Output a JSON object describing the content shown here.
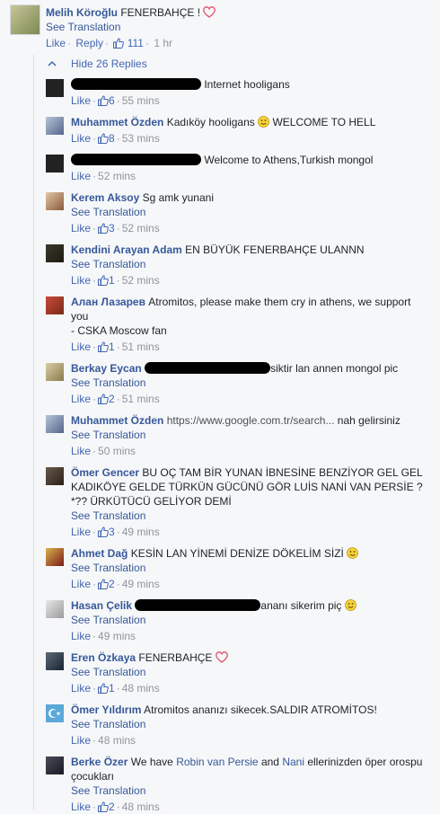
{
  "main_comment": {
    "author": "Melih Köroğlu",
    "text": "FENERBAHÇE !",
    "see_translation": "See Translation",
    "like": "Like",
    "reply": "Reply",
    "likes": "111",
    "time": "1 hr"
  },
  "hide_replies": "Hide 26 Replies",
  "replies": [
    {
      "author": "",
      "text": "Internet hooligans",
      "like": "Like",
      "likes": "6",
      "time": "55 mins"
    },
    {
      "author": "Muhammet Özden",
      "text": "Kadıköy hooligans",
      "text2": "WELCOME TO HELL",
      "like": "Like",
      "likes": "8",
      "time": "53 mins"
    },
    {
      "author": "",
      "text": "Welcome to Athens,Turkish mongol",
      "like": "Like",
      "time": "52 mins"
    },
    {
      "author": "Kerem Aksoy",
      "text": "Sg amk yunani",
      "see_translation": "See Translation",
      "like": "Like",
      "likes": "3",
      "time": "52 mins"
    },
    {
      "author": "Kendini Arayan Adam",
      "text": "EN BÜYÜK FENERBAHÇE ULANNN",
      "see_translation": "See Translation",
      "like": "Like",
      "likes": "1",
      "time": "52 mins"
    },
    {
      "author": "Алан Лазарев",
      "text": "Atromitos, please make them cry in athens, we support you",
      "text2": "- CSKA Moscow fan",
      "like": "Like",
      "likes": "1",
      "time": "51 mins"
    },
    {
      "author": "Berkay Eycan",
      "text": "siktir lan annen mongol pic",
      "see_translation": "See Translation",
      "like": "Like",
      "likes": "2",
      "time": "51 mins"
    },
    {
      "author": "Muhammet Özden",
      "text": "https://www.google.com.tr/search...",
      "text2": "nah gelirsiniz",
      "see_translation": "See Translation",
      "like": "Like",
      "time": "50 mins"
    },
    {
      "author": "Ömer Gencer",
      "text": "BU OÇ TAM BİR YUNAN İBNESİNE BENZİYOR GEL GEL KADIKÖYE GELDE TÜRKÜN GÜCÜNÜ GÖR LUİS NANİ VAN PERSİE ?*?? ÜRKÜTÜCÜ GELİYOR DEMİ",
      "see_translation": "See Translation",
      "like": "Like",
      "likes": "3",
      "time": "49 mins"
    },
    {
      "author": "Ahmet Dağ",
      "text": "KESİN LAN YİNEMİ DENİZE DÖKELİM SİZİ",
      "see_translation": "See Translation",
      "like": "Like",
      "likes": "2",
      "time": "49 mins"
    },
    {
      "author": "Hasan Çelik",
      "text": "ananı sikerim piç",
      "see_translation": "See Translation",
      "like": "Like",
      "time": "49 mins"
    },
    {
      "author": "Eren Özkaya",
      "text": "FENERBAHÇE",
      "see_translation": "See Translation",
      "like": "Like",
      "likes": "1",
      "time": "48 mins"
    },
    {
      "author": "Ömer Yıldırım",
      "text": "Atromitos ananızı sikecek.SALDIR ATROMİTOS!",
      "see_translation": "See Translation",
      "like": "Like",
      "time": "48 mins"
    },
    {
      "author": "Berke Özer",
      "text_a": "We have",
      "link_a": "Robin van Persie",
      "text_b": "and",
      "link_b": "Nani",
      "text_c": "ellerinizden öper orospu çocukları",
      "see_translation": "See Translation",
      "like": "Like",
      "likes": "2",
      "time": "48 mins"
    }
  ],
  "colors": {
    "link": "#365899",
    "meta": "#90949c",
    "background": "#f6f7f9",
    "heart": "#e25a72"
  }
}
